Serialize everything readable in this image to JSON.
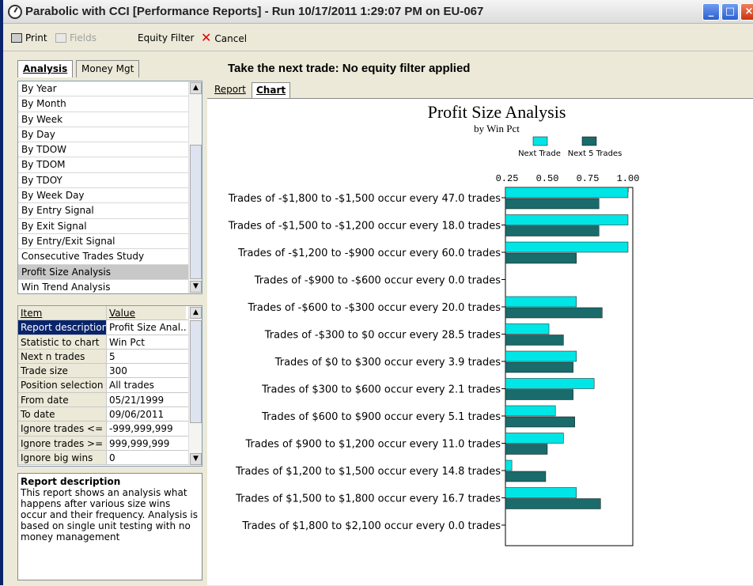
{
  "window": {
    "title": "Parabolic with CCI  [Performance Reports]  -  Run 10/17/2011 1:29:07 PM on EU-067"
  },
  "toolbar": {
    "print_label": "Print",
    "fields_label": "Fields",
    "equity_label": "Equity Filter",
    "cancel_label": "Cancel"
  },
  "left_tabs": {
    "analysis": "Analysis",
    "money": "Money Mgt"
  },
  "report_list": [
    "By Year",
    "By Month",
    "By Week",
    "By Day",
    "By TDOW",
    "By TDOM",
    "By TDOY",
    "By Week Day",
    "By Entry Signal",
    "By Exit Signal",
    "By Entry/Exit Signal",
    "Consecutive Trades Study",
    "Profit Size Analysis",
    "Win Trend Analysis"
  ],
  "report_selected": "Profit Size Analysis",
  "grid": {
    "header": {
      "item": "Item",
      "value": "Value"
    },
    "rows": [
      {
        "item": "Report description",
        "value": "Profit Size Anal..."
      },
      {
        "item": "Statistic to chart",
        "value": "Win Pct"
      },
      {
        "item": "Next n trades",
        "value": "5"
      },
      {
        "item": "Trade size",
        "value": "300"
      },
      {
        "item": "Position selection",
        "value": "All trades"
      },
      {
        "item": "From date",
        "value": "05/21/1999"
      },
      {
        "item": "To date",
        "value": "09/06/2011"
      },
      {
        "item": "Ignore trades <=",
        "value": "-999,999,999"
      },
      {
        "item": "Ignore trades >=",
        "value": "999,999,999"
      },
      {
        "item": "Ignore big wins",
        "value": "0"
      }
    ]
  },
  "description": {
    "title": "Report description",
    "text": "This report shows an analysis what happens after various size wins occur and their frequency.  Analysis is based on single unit testing with no money management"
  },
  "heading": "Take the next trade: No equity filter applied",
  "right_tabs": {
    "report": "Report",
    "chart": "Chart"
  },
  "colors": {
    "series1": "#00e5e5",
    "series2": "#1a6b6b"
  },
  "chart_data": {
    "type": "bar",
    "orientation": "horizontal",
    "title": "Profit Size Analysis",
    "subtitle": "by Win Pct",
    "xlim": [
      0.25,
      1.0
    ],
    "xticks": [
      "0.25",
      "0.50",
      "0.75",
      "1.00"
    ],
    "legend_position": "top-right",
    "categories": [
      "Trades of -$1,800 to -$1,500 occur every 47.0 trades",
      "Trades of -$1,500 to -$1,200 occur every 18.0 trades",
      "Trades of -$1,200 to -$900 occur every 60.0 trades",
      "Trades of -$900 to -$600 occur every 0.0 trades",
      "Trades of -$600 to -$300 occur every 20.0 trades",
      "Trades of -$300 to $0 occur every 28.5 trades",
      "Trades of $0 to $300 occur every 3.9 trades",
      "Trades of $300 to $600 occur every 2.1 trades",
      "Trades of $600 to $900 occur every 5.1 trades",
      "Trades of $900 to $1,200 occur every 11.0 trades",
      "Trades of $1,200 to $1,500 occur every 14.8 trades",
      "Trades of $1,500 to $1,800 occur every 16.7 trades",
      "Trades of $1,800 to $2,100 occur every 0.0 trades"
    ],
    "series": [
      {
        "name": "Next Trade",
        "values": [
          1.0,
          1.0,
          1.0,
          null,
          0.68,
          0.51,
          0.68,
          0.79,
          0.55,
          0.6,
          0.28,
          0.68,
          null
        ]
      },
      {
        "name": "Next 5 Trades",
        "values": [
          0.82,
          0.82,
          0.68,
          null,
          0.84,
          0.6,
          0.66,
          0.66,
          0.67,
          0.5,
          0.49,
          0.83,
          null
        ]
      }
    ]
  }
}
